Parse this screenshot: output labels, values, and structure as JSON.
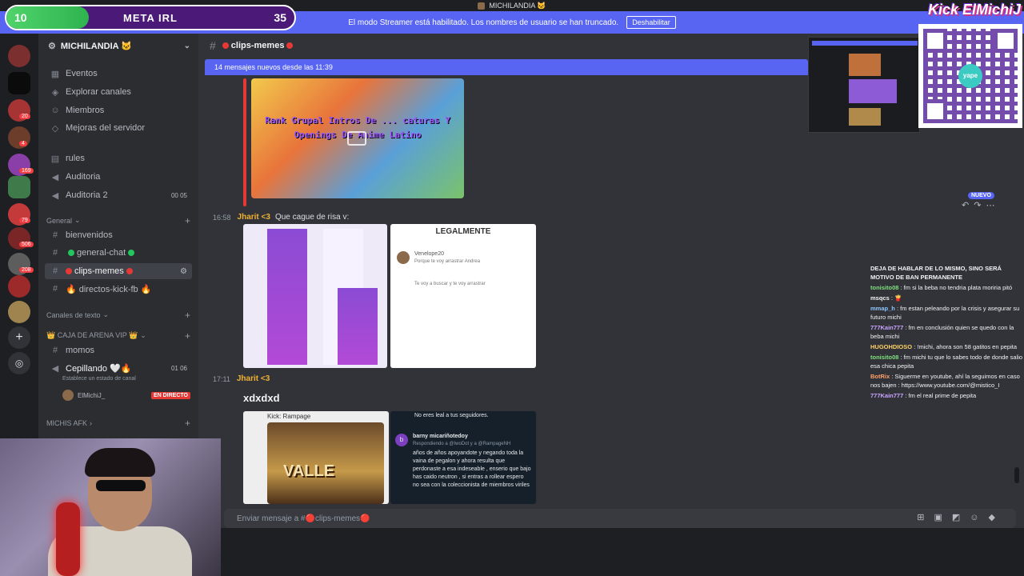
{
  "window": {
    "title": "MICHILANDIA 🐱"
  },
  "banner": {
    "text": "El modo Streamer está habilitado. Los nombres de usuario se han truncado.",
    "button": "Deshabilitar"
  },
  "meta_bar": {
    "current": "10",
    "title": "META IRL",
    "goal": "35",
    "progress_fraction": 0.286
  },
  "kick_overlay": "Kick ElMichiJ",
  "server": {
    "name": "MICHILANDIA 🐱"
  },
  "rail": {
    "badges": [
      "20",
      "4",
      "169",
      "79",
      "506",
      "208"
    ]
  },
  "sidebar": {
    "top_items": [
      {
        "label": "Eventos",
        "icon": "calendar-icon"
      },
      {
        "label": "Explorar canales",
        "icon": "compass-icon"
      },
      {
        "label": "Miembros",
        "icon": "members-icon"
      },
      {
        "label": "Mejoras del servidor",
        "icon": "boost-icon"
      }
    ],
    "channels_top": [
      {
        "label": "rules",
        "icon": "rules-icon"
      },
      {
        "label": "Auditoria",
        "icon": "speaker-icon"
      },
      {
        "label": "Auditoria 2",
        "icon": "speaker-icon",
        "right": "00 05"
      }
    ],
    "category_general": "General",
    "general_channels": [
      {
        "label": "bienvenidos"
      },
      {
        "label": "general-chat"
      },
      {
        "label": "clips-memes"
      },
      {
        "label": "directos-kick-fb 🔥"
      }
    ],
    "category_text": "Canales de texto",
    "category_vip": "👑 CAJA DE ARENA VIP 👑",
    "vip_channel": "momos",
    "voice_channel": {
      "label": "Cepillando 🤍🔥",
      "status": "Establece un estado de canal",
      "right": "01 06"
    },
    "voice_member": {
      "name": "ElMichiJ_",
      "live": "EN DIRECTO"
    },
    "category_afk": "MICHIS AFK"
  },
  "channel_header": {
    "name": "clips-memes"
  },
  "new_messages": "14 mensajes nuevos desde las 11:39",
  "messages": [
    {
      "time": "16:58",
      "user": "Jharit <3",
      "text": "Que cague de risa v:"
    },
    {
      "time": "17:11",
      "user": "Jharit <3",
      "text": "xdxdxd"
    }
  ],
  "video_embed": {
    "title": "Rank Grupal Intros De ... caturas Y Openings De Anime Latino"
  },
  "image_legalmente": {
    "header": "LEGALMENTE",
    "name": "Venelope20",
    "line1": "Porque te voy arrastrar Andrea",
    "line2": "Te voy a buscar y te voy arrastrar"
  },
  "image_kick": {
    "label": "Kick: Rampage",
    "poster": "VALLE"
  },
  "image_tweet": {
    "top": "No eres leal a tus seguidores.",
    "avatar": "b",
    "user": "barny micariñotedoy",
    "reply": "Respondiendo a @IwoDot y a @RampageNH",
    "body": "años de años apoyandote y negando toda la vaina de pegalon y ahora resulta que perdonaste a esa indeseable , enserio que bajo has caido neutron , si entras a rollear espero no sea con la coleccionista de miembros viriles"
  },
  "nuevo_badge": "NUEVO",
  "composer": {
    "placeholder": "Enviar mensaje a #🔴clips-memes🔴"
  },
  "qr": {
    "brand": "yape"
  },
  "stream_chat": {
    "warning": "DEJA DE HABLAR DE LO MISMO, SINO SERÁ MOTIVO DE BAN PERMANENTE",
    "lines": [
      {
        "user": "tonisito08",
        "text": ": fm si la beba no tendria plata moriria pitó"
      },
      {
        "user": "msqcs",
        "text": ": 🍟"
      },
      {
        "user": "mmap_h",
        "text": ": fm estan peleando por la crisis y asegurar su futuro michi"
      },
      {
        "user": "777Kain777",
        "text": ": fm en conclusión quien se quedo con la beba michi"
      },
      {
        "user": "HUGOHDIOSO",
        "text": ": !michi, ahora son 58 gatitos en pepita"
      },
      {
        "user": "tonisito08",
        "text": ": fm michi tu que lo sabes todo de donde salio esa chica pepita"
      },
      {
        "user": "BotRix",
        "text": ": Siguerme en youtube, ahí la seguimos en caso nos bajen : https://www.youtube.com/@mistico_I"
      },
      {
        "user": "777Kain777",
        "text": ": fm el real prime de pepita"
      }
    ]
  },
  "colors": {
    "accent": "#5865f2",
    "live": "#e53935",
    "username": "#f0b132"
  }
}
